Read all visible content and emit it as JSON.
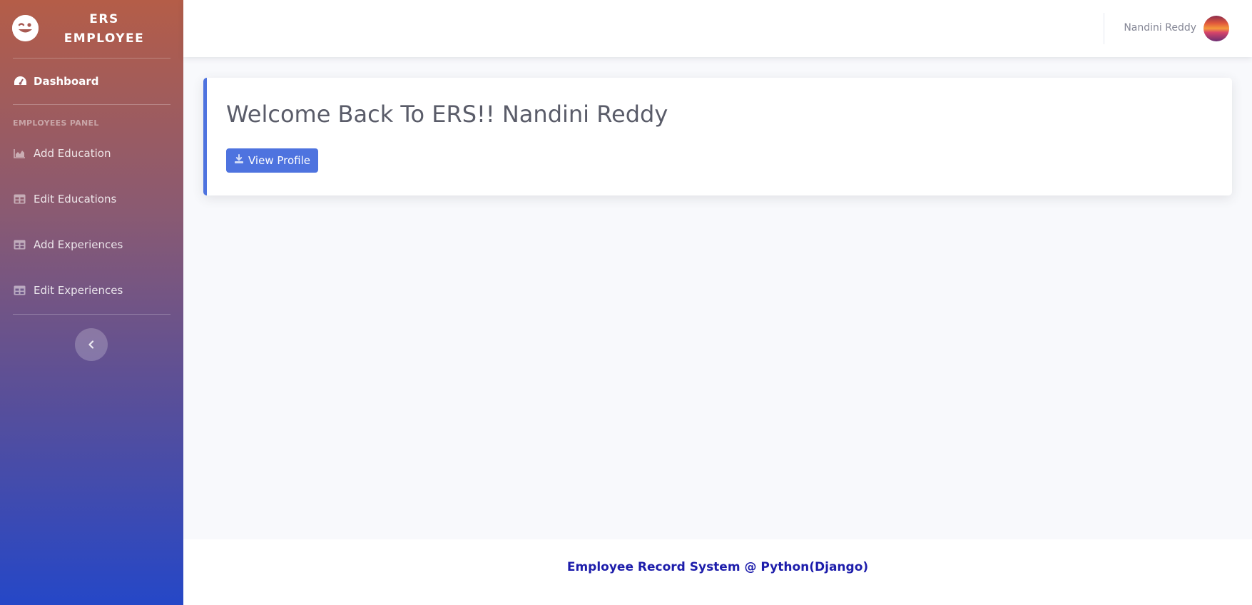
{
  "brand": {
    "line1": "ERS",
    "line2": "EMPLOYEE",
    "icon": "wink-icon"
  },
  "sidebar": {
    "dashboard": {
      "label": "Dashboard",
      "icon": "tachometer-icon"
    },
    "section_heading": "EMPLOYEES PANEL",
    "items": [
      {
        "label": "Add Education",
        "icon": "area-chart-icon"
      },
      {
        "label": "Edit Educations",
        "icon": "table-icon"
      },
      {
        "label": "Add Experiences",
        "icon": "table-icon"
      },
      {
        "label": "Edit Experiences",
        "icon": "table-icon"
      }
    ],
    "toggle_icon": "chevron-left-icon"
  },
  "topbar": {
    "user_name": "Nandini Reddy"
  },
  "main": {
    "welcome": "Welcome Back To ERS!! Nandini Reddy",
    "view_profile_label": "View Profile",
    "view_profile_icon": "download-icon"
  },
  "footer": {
    "text": "Employee Record System @ Python(Django)"
  },
  "colors": {
    "primary": "#4e73df",
    "sidebar_top": "#b45d48",
    "sidebar_bottom": "#2547c7",
    "footer_text": "#1d1dab"
  }
}
